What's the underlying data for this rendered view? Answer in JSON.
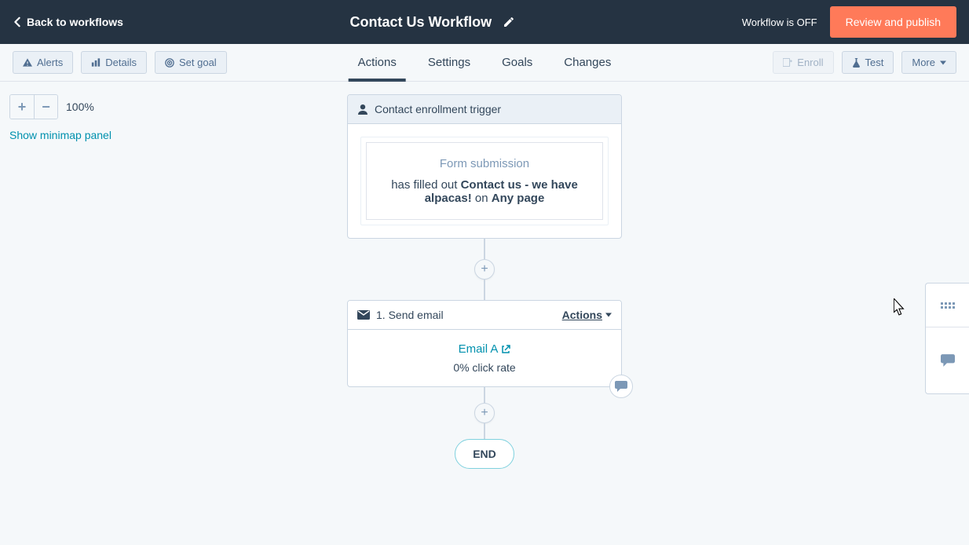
{
  "topbar": {
    "back_label": "Back to workflows",
    "title": "Contact Us Workflow",
    "status": "Workflow is OFF",
    "publish_label": "Review and publish"
  },
  "subbar": {
    "alerts": "Alerts",
    "details": "Details",
    "goal": "Set goal",
    "enroll": "Enroll",
    "test": "Test",
    "more": "More"
  },
  "tabs": {
    "actions": "Actions",
    "settings": "Settings",
    "goals": "Goals",
    "changes": "Changes"
  },
  "zoom": {
    "level": "100%",
    "minimap": "Show minimap panel"
  },
  "trigger": {
    "head": "Contact enrollment trigger",
    "label": "Form submission",
    "pre": "has filled out ",
    "form": "Contact us - we have alpacas!",
    "mid": " on ",
    "page": "Any page"
  },
  "email_step": {
    "head": "1. Send email",
    "actions_label": "Actions",
    "link": "Email A",
    "metric": "0% click rate"
  },
  "end": "END"
}
